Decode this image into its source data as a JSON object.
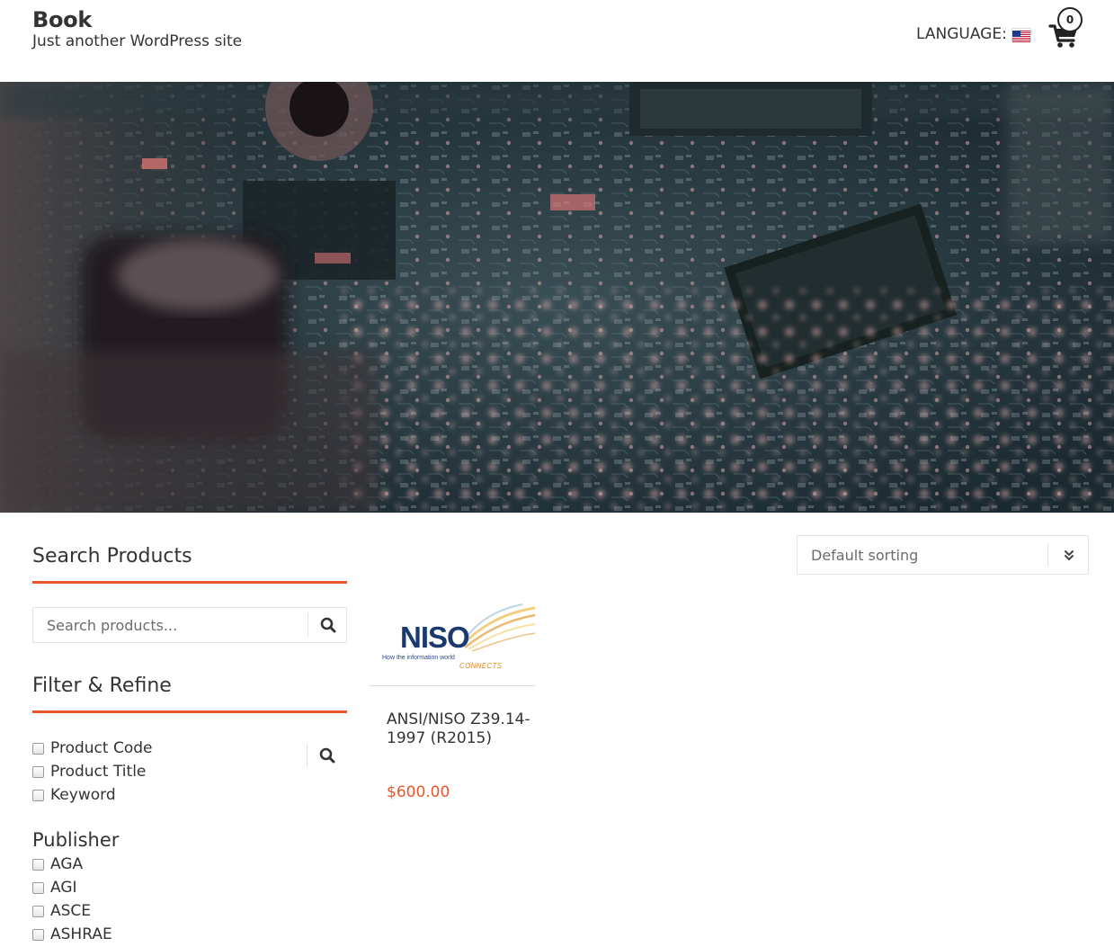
{
  "header": {
    "site_title": "Book",
    "tagline": "Just another WordPress site",
    "language_label": "LANGUAGE:",
    "language_flag": "us-flag-icon",
    "cart_count": "0"
  },
  "colors": {
    "accent": "#e8572a",
    "text": "#333333",
    "niso_blue": "#1a3a6e"
  },
  "sidebar": {
    "search_title": "Search Products",
    "search_placeholder": "Search products...",
    "filter_title": "Filter & Refine",
    "filter_options": [
      "Product Code",
      "Product Title",
      "Keyword"
    ],
    "publisher_title": "Publisher",
    "publishers": [
      "AGA",
      "AGI",
      "ASCE",
      "ASHRAE"
    ]
  },
  "sorting": {
    "selected": "Default sorting"
  },
  "products": [
    {
      "logo_text": "NISO",
      "logo_tagline": "How the information world",
      "logo_connects": "CONNECTS",
      "title": "ANSI/NISO Z39.14-1997 (R2015)",
      "price": "$600.00"
    }
  ]
}
